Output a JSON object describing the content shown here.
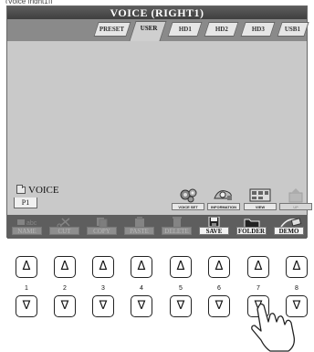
{
  "caption_fragment": "(Voice [right1])",
  "window": {
    "title": "VOICE (RIGHT1)"
  },
  "tabs": [
    {
      "label": "PRESET",
      "selected": false
    },
    {
      "label": "USER",
      "selected": true
    },
    {
      "label": "HD1",
      "selected": false
    },
    {
      "label": "HD2",
      "selected": false
    },
    {
      "label": "HD3",
      "selected": false
    },
    {
      "label": "USB1",
      "selected": false
    }
  ],
  "current_folder": "VOICE",
  "page_tab": "P1",
  "icon_buttons": [
    {
      "label": "VOICE SET",
      "icon": "gears-icon",
      "enabled": true
    },
    {
      "label": "INFORMATION",
      "icon": "info-icon",
      "enabled": true
    },
    {
      "label": "VIEW",
      "icon": "view-icon",
      "enabled": true
    },
    {
      "label": "UP",
      "icon": "up-icon",
      "enabled": false
    }
  ],
  "bottom_buttons": [
    {
      "label": "NAME",
      "icon": "name-icon",
      "enabled": false
    },
    {
      "label": "CUT",
      "icon": "scissors-icon",
      "enabled": false
    },
    {
      "label": "COPY",
      "icon": "copy-icon",
      "enabled": false
    },
    {
      "label": "PASTE",
      "icon": "paste-icon",
      "enabled": false
    },
    {
      "label": "DELETE",
      "icon": "trash-icon",
      "enabled": false
    },
    {
      "label": "SAVE",
      "icon": "floppy-icon",
      "enabled": true
    },
    {
      "label": "FOLDER",
      "icon": "folder-icon",
      "enabled": true
    },
    {
      "label": "DEMO",
      "icon": "demo-icon",
      "enabled": true
    }
  ],
  "hardware_buttons": {
    "up_symbol": "Δ",
    "down_symbol": "∇",
    "numbers": [
      "1",
      "2",
      "3",
      "4",
      "5",
      "6",
      "7",
      "8"
    ]
  }
}
